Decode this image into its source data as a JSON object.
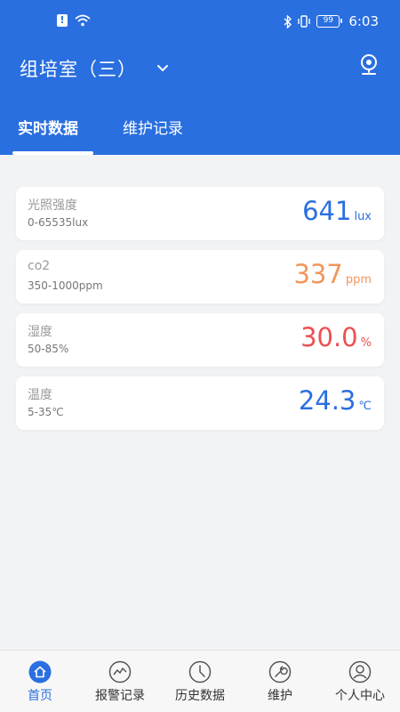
{
  "status_bar": {
    "time": "6:03",
    "battery": "99"
  },
  "header": {
    "title": "组培室（三）",
    "tabs": [
      {
        "label": "实时数据",
        "active": true
      },
      {
        "label": "维护记录",
        "active": false
      }
    ]
  },
  "readings": [
    {
      "name": "光照强度",
      "range": "0-65535lux",
      "value": "641",
      "unit": "lux",
      "color": "#2a6fdf"
    },
    {
      "name": "co2",
      "range": "350-1000ppm",
      "value": "337",
      "unit": "ppm",
      "color": "#f0965a"
    },
    {
      "name": "湿度",
      "range": "50-85%",
      "value": "30.0",
      "unit": "%",
      "color": "#ef4f50"
    },
    {
      "name": "温度",
      "range": "5-35℃",
      "value": "24.3",
      "unit": "℃",
      "color": "#2a6fdf"
    }
  ],
  "nav": [
    {
      "label": "首页",
      "icon": "home-icon",
      "active": true
    },
    {
      "label": "报警记录",
      "icon": "trend-alarm-icon",
      "active": false
    },
    {
      "label": "历史数据",
      "icon": "clock-icon",
      "active": false
    },
    {
      "label": "维护",
      "icon": "wrench-icon",
      "active": false
    },
    {
      "label": "个人中心",
      "icon": "user-icon",
      "active": false
    }
  ],
  "colors": {
    "primary": "#2a6fdf",
    "orange": "#f0965a",
    "red": "#ef4f50"
  }
}
